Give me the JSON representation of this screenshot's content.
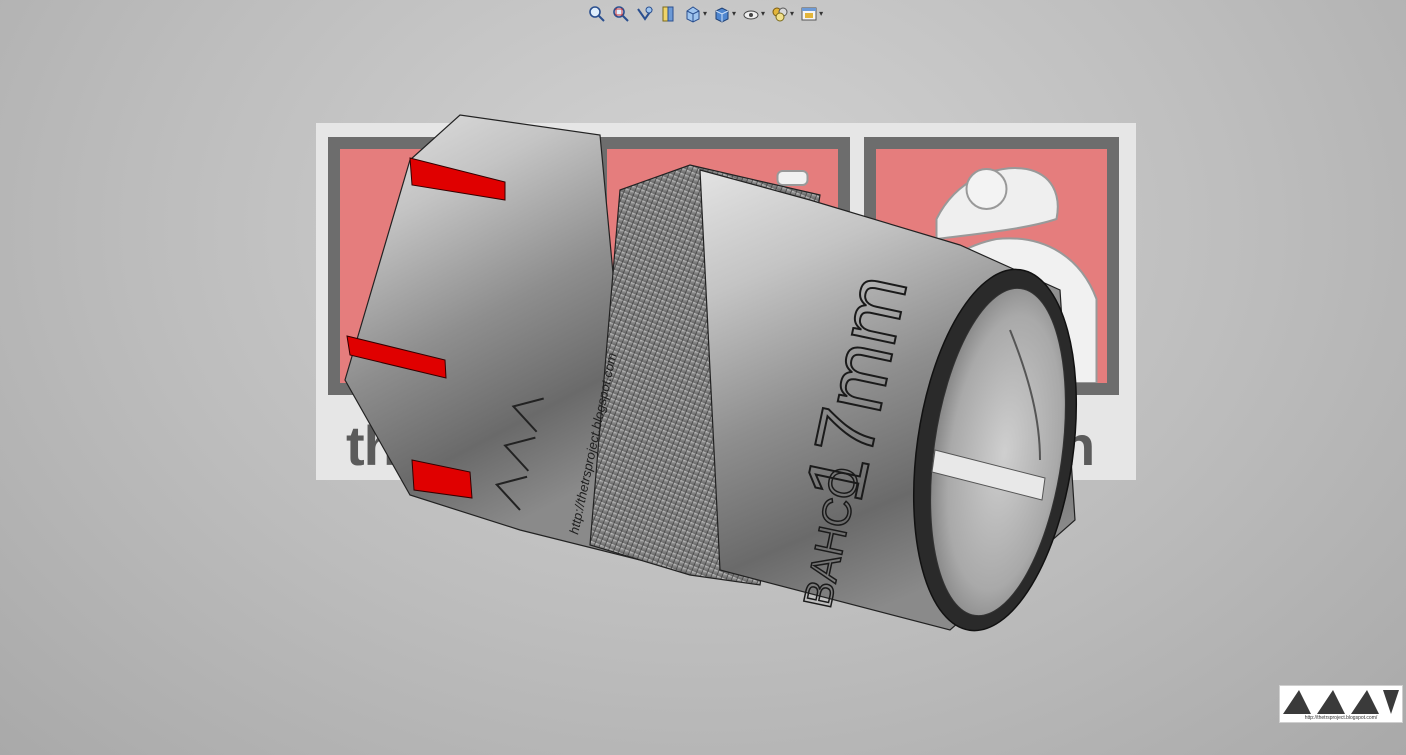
{
  "toolbar": {
    "buttons": [
      {
        "name": "zoom-to-fit",
        "icon": "zoom-fit-icon",
        "dropdown": false
      },
      {
        "name": "zoom-to-area",
        "icon": "zoom-area-icon",
        "dropdown": false
      },
      {
        "name": "previous-view",
        "icon": "previous-view-icon",
        "dropdown": false
      },
      {
        "name": "section-view",
        "icon": "section-view-icon",
        "dropdown": false
      },
      {
        "name": "view-orientation",
        "icon": "view-orientation-icon",
        "dropdown": true
      },
      {
        "name": "display-style",
        "icon": "display-style-icon",
        "dropdown": true
      },
      {
        "name": "hide-show-items",
        "icon": "hide-show-icon",
        "dropdown": true
      },
      {
        "name": "edit-appearance",
        "icon": "appearance-icon",
        "dropdown": true
      },
      {
        "name": "view-settings",
        "icon": "view-settings-icon",
        "dropdown": true
      }
    ]
  },
  "backdrop": {
    "brand_prefix": "the",
    "brand_suffix": "n"
  },
  "part": {
    "size_engraving": "17mm",
    "maker_engraving": "BAHCO",
    "url_engraving": "http://thetrsproject.blogspot.com",
    "accent_color": "#e00000",
    "body_color": "#8c8c8c"
  },
  "corner_logo": {
    "url": "http://thetrsproject.blogspot.com/"
  }
}
